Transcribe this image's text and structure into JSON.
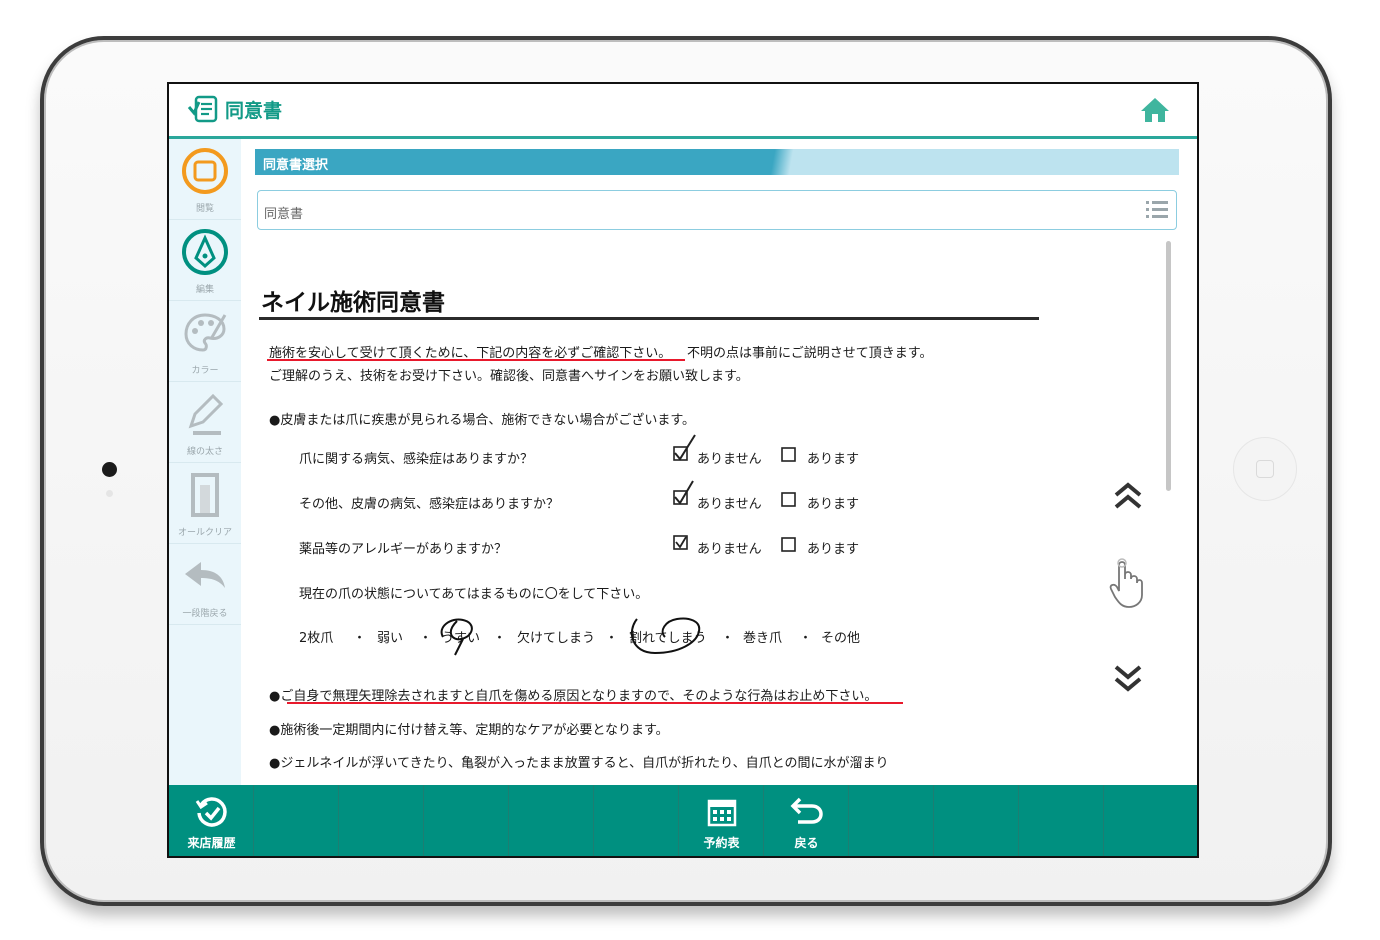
{
  "app": {
    "title": "同意書"
  },
  "sidebar": {
    "items": [
      {
        "label": "閲覧",
        "icon": "view-frame-icon"
      },
      {
        "label": "編集",
        "icon": "edit-pen-icon"
      },
      {
        "label": "カラー",
        "icon": "palette-icon"
      },
      {
        "label": "線の太さ",
        "icon": "pencil-icon"
      },
      {
        "label": "オールクリア",
        "icon": "clear-icon"
      },
      {
        "label": "一段階戻る",
        "icon": "undo-arrow-icon"
      }
    ]
  },
  "section": {
    "title": "同意書選択"
  },
  "select": {
    "value": "同意書"
  },
  "document": {
    "title": "ネイル施術同意書",
    "intro_line1_red": "施術を安心して受けて頂くために、下記の内容を必ずご確認下さい。",
    "intro_line1_rest": "不明の点は事前にご説明させて頂きます。",
    "intro_line2": "ご理解のうえ、技術をお受け下さい。確認後、同意書へサインをお願い致します。",
    "bullet1": "●皮膚または爪に疾患が見られる場合、施術できない場合がございます。",
    "questions": [
      {
        "text": "爪に関する病気、感染症はありますか？",
        "opt_no": "ありません",
        "opt_yes": "あります",
        "checked": "ありません"
      },
      {
        "text": "その他、皮膚の病気、感染症はありますか？",
        "opt_no": "ありません",
        "opt_yes": "あります",
        "checked": "ありません"
      },
      {
        "text": "薬品等のアレルギーがありますか？",
        "opt_no": "ありません",
        "opt_yes": "あります",
        "checked": "ありません"
      }
    ],
    "nail_state_q": "現在の爪の状態についてあてはまるものに〇をして下さい。",
    "nail_states": [
      "2枚爪",
      "弱い",
      "うすい",
      "欠けてしまう",
      "割れてしまう",
      "巻き爪",
      "その他"
    ],
    "nail_sep": "・",
    "bullet2": "●ご自身で無理矢理除去されますと自爪を傷める原因となりますので、そのような行為はお止め下さい。",
    "bullet3": "●施術後一定期間内に付け替え等、定期的なケアが必要となります。",
    "bullet4": "●ジェルネイルが浮いてきたり、亀裂が入ったまま放置すると、自爪が折れたり、自爪との間に水が溜まり"
  },
  "bottom_bar": {
    "history": "来店履歴",
    "reservation": "予約表",
    "back": "戻る"
  },
  "colors": {
    "accent": "#009080",
    "section": "#3aa6c2",
    "orange": "#f39a1e",
    "underline": "#e8192c"
  }
}
